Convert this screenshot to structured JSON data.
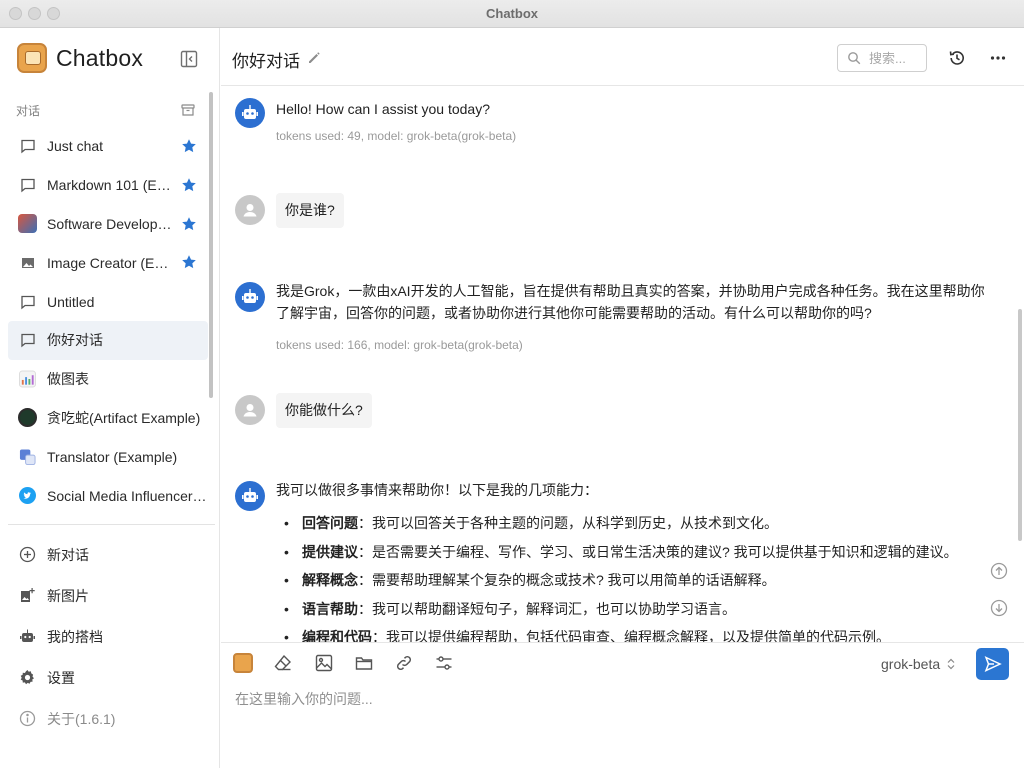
{
  "window": {
    "title": "Chatbox"
  },
  "sidebar": {
    "brand": "Chatbox",
    "section_label": "对话",
    "conversations": [
      {
        "label": "Just chat",
        "starred": true
      },
      {
        "label": "Markdown 101 (Example)",
        "starred": true
      },
      {
        "label": "Software Developer (Example)",
        "starred": true
      },
      {
        "label": "Image Creator (Example)",
        "starred": true
      },
      {
        "label": "Untitled",
        "starred": false
      },
      {
        "label": "你好对话",
        "starred": false,
        "active": true
      },
      {
        "label": "做图表",
        "starred": false
      },
      {
        "label": "贪吃蛇(Artifact Example)",
        "starred": false
      },
      {
        "label": "Translator (Example)",
        "starred": false
      },
      {
        "label": "Social Media Influencer (Example)",
        "starred": false
      }
    ],
    "menu": {
      "new_chat": "新对话",
      "new_image": "新图片",
      "my_partner": "我的搭档",
      "settings": "设置",
      "about": "关于(1.6.1)"
    }
  },
  "header": {
    "title": "你好对话",
    "search_placeholder": "搜索..."
  },
  "messages": [
    {
      "role": "assistant",
      "text": "Hello! How can I assist you today?",
      "meta": "tokens used: 49, model: grok-beta(grok-beta)"
    },
    {
      "role": "user",
      "text": "你是谁?"
    },
    {
      "role": "assistant",
      "text_line1": "我是Grok，一款由xAI开发的人工智能，旨在提供有帮助且真实的答案，并协助用户完成各种任务。我在这里帮助你",
      "text_line2": "了解宇宙，回答你的问题，或者协助你进行其他你可能需要帮助的活动。有什么可以帮助你的吗?",
      "meta": "tokens used: 166, model: grok-beta(grok-beta)"
    },
    {
      "role": "user",
      "text": "你能做什么?"
    },
    {
      "role": "assistant",
      "intro": "我可以做很多事情来帮助你！以下是我的几项能力：",
      "items": [
        {
          "key": "回答问题",
          "text": "：我可以回答关于各种主题的问题，从科学到历史，从技术到文化。"
        },
        {
          "key": "提供建议",
          "text": "：是否需要关于编程、写作、学习、或日常生活决策的建议? 我可以提供基于知识和逻辑的建议。"
        },
        {
          "key": "解释概念",
          "text": "：需要帮助理解某个复杂的概念或技术? 我可以用简单的话语解释。"
        },
        {
          "key": "语言帮助",
          "text": "：我可以帮助翻译短句子，解释词汇，也可以协助学习语言。"
        },
        {
          "key": "编程和代码",
          "text": "：我可以提供编程帮助，包括代码审查、编程概念解释，以及提供简单的代码示例。"
        }
      ]
    }
  ],
  "composer": {
    "model": "grok-beta",
    "input_placeholder": "在这里输入你的问题..."
  },
  "colors": {
    "accent": "#2b76d2",
    "active_row": "#eef2f7",
    "bot_avatar": "#2c6fd1"
  }
}
